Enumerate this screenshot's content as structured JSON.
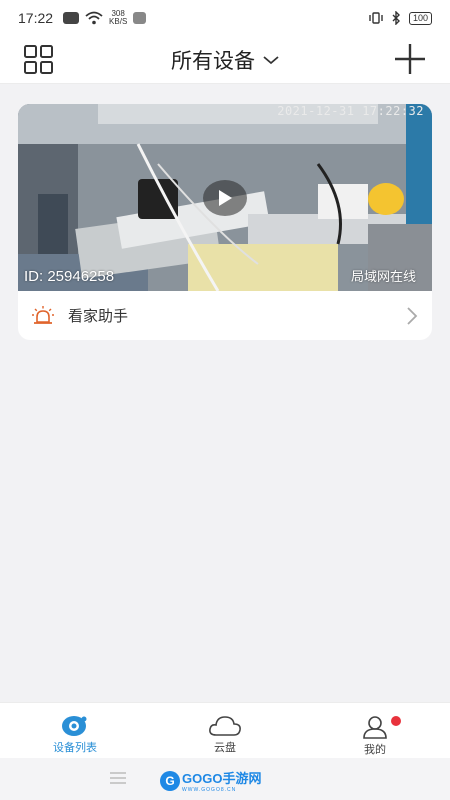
{
  "status_bar": {
    "time": "17:22",
    "net_speed_value": "308",
    "net_speed_unit": "KB/S",
    "battery": "100"
  },
  "header": {
    "title": "所有设备"
  },
  "device": {
    "timestamp": "2021-12-31  17:22:32",
    "id_text": "ID: 25946258",
    "status": "局域网在线"
  },
  "assistant": {
    "label": "看家助手"
  },
  "tabs": [
    {
      "label": "设备列表",
      "icon": "camera-icon",
      "active": true
    },
    {
      "label": "云盘",
      "icon": "cloud-icon",
      "active": false
    },
    {
      "label": "我的",
      "icon": "person-icon",
      "active": false
    }
  ],
  "watermark": {
    "brand": "GOGO手游网",
    "url": "WWW.GOGO8.CN"
  },
  "colors": {
    "accent": "#2a8fd6",
    "badge": "#e8323c",
    "alarm": "#e0642c"
  }
}
